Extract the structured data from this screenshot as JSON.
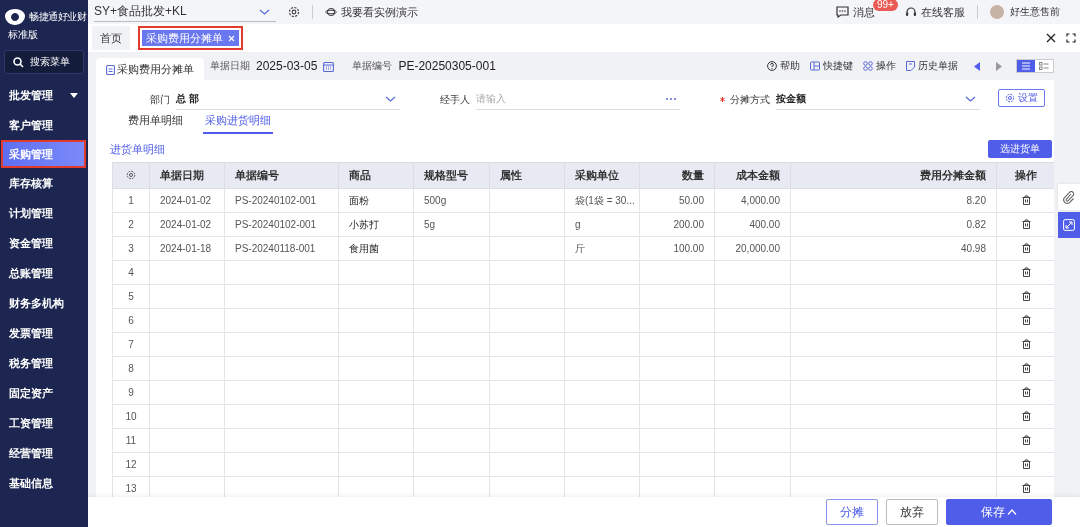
{
  "sidebar": {
    "brand": "畅捷通好业财",
    "edition": "标准版",
    "search": "搜索菜单",
    "items": [
      {
        "label": "批发管理",
        "selected": false,
        "outlined": false,
        "has_caret": true
      },
      {
        "label": "客户管理",
        "selected": false,
        "outlined": false,
        "has_caret": false
      },
      {
        "label": "采购管理",
        "selected": true,
        "outlined": true,
        "has_caret": false
      },
      {
        "label": "库存核算",
        "selected": false,
        "outlined": false,
        "has_caret": false
      },
      {
        "label": "计划管理",
        "selected": false,
        "outlined": false,
        "has_caret": false
      },
      {
        "label": "资金管理",
        "selected": false,
        "outlined": false,
        "has_caret": false
      },
      {
        "label": "总账管理",
        "selected": false,
        "outlined": false,
        "has_caret": false
      },
      {
        "label": "财务多机构",
        "selected": false,
        "outlined": false,
        "has_caret": false
      },
      {
        "label": "发票管理",
        "selected": false,
        "outlined": false,
        "has_caret": false
      },
      {
        "label": "税务管理",
        "selected": false,
        "outlined": false,
        "has_caret": false
      },
      {
        "label": "固定资产",
        "selected": false,
        "outlined": false,
        "has_caret": false
      },
      {
        "label": "工资管理",
        "selected": false,
        "outlined": false,
        "has_caret": false
      },
      {
        "label": "经营管理",
        "selected": false,
        "outlined": false,
        "has_caret": false
      },
      {
        "label": "基础信息",
        "selected": false,
        "outlined": false,
        "has_caret": false
      }
    ]
  },
  "top_bar": {
    "account": "SY+食品批发+KL",
    "demo": "我要看实例演示",
    "messages": {
      "label": "消息",
      "badge": "99+"
    },
    "support": "在线客服",
    "user": "好生意售前"
  },
  "tabs": [
    {
      "label": "首页",
      "selected": false,
      "outlined": false,
      "closable": false
    },
    {
      "label": "采购费用分摊单",
      "selected": true,
      "outlined": true,
      "closable": true
    }
  ],
  "document": {
    "title": "采购费用分摊单",
    "date_label": "单据日期",
    "date": "2025-03-05",
    "number_label": "单据编号",
    "number": "PE-20250305-001",
    "toolbar": [
      {
        "kind": "help",
        "label": "帮助"
      },
      {
        "kind": "shortcut",
        "label": "快捷键"
      },
      {
        "kind": "action",
        "label": "操作"
      },
      {
        "kind": "history",
        "label": "历史单据"
      }
    ],
    "views": [
      {
        "kind": "list",
        "selected": true
      },
      {
        "kind": "detail",
        "selected": false
      }
    ]
  },
  "form": {
    "fields": [
      {
        "label": "部门",
        "required": false,
        "value": "总 部",
        "kind": "dropdown"
      },
      {
        "label": "经手人",
        "required": false,
        "placeholder": "请输入",
        "kind": "picker"
      },
      {
        "label": "分摊方式",
        "required": true,
        "value": "按金额",
        "kind": "dropdown"
      }
    ],
    "settings_button": "设置"
  },
  "subtabs": [
    {
      "label": "费用单明细",
      "selected": false
    },
    {
      "label": "采购进货明细",
      "selected": true
    }
  ],
  "section": {
    "title": "进货单明细",
    "button": "选进货单"
  },
  "table": {
    "columns": [
      "单据日期",
      "单据编号",
      "商品",
      "规格型号",
      "属性",
      "采购单位",
      "数量",
      "成本金额",
      "费用分摊金额"
    ],
    "action_column": "操作",
    "rows": [
      {
        "no": "1",
        "date": "2024-01-02",
        "number": "PS-20240102-001",
        "product": "面粉",
        "spec": "500g",
        "unit": "袋(1袋 = 30...",
        "qty": "50.00",
        "cost": "4,000.00",
        "allocated": "8.20"
      },
      {
        "no": "2",
        "date": "2024-01-02",
        "number": "PS-20240102-001",
        "product": "小苏打",
        "spec": "5g",
        "unit": "g",
        "qty": "200.00",
        "cost": "400.00",
        "allocated": "0.82"
      },
      {
        "no": "3",
        "date": "2024-01-18",
        "number": "PS-20240118-001",
        "product": "食用菌",
        "unit": "斤",
        "qty": "100.00",
        "cost": "20,000.00",
        "allocated": "40.98"
      },
      {
        "no": "4"
      },
      {
        "no": "5"
      },
      {
        "no": "6"
      },
      {
        "no": "7"
      },
      {
        "no": "8"
      },
      {
        "no": "9"
      },
      {
        "no": "10"
      },
      {
        "no": "11"
      },
      {
        "no": "12"
      },
      {
        "no": "13"
      }
    ]
  },
  "footer": {
    "buttons": [
      {
        "kind": "outline-primary",
        "label": "分摊",
        "caret": false
      },
      {
        "kind": "outline",
        "label": "放弃",
        "caret": false
      },
      {
        "kind": "primary",
        "label": "保存",
        "caret": true
      }
    ]
  }
}
